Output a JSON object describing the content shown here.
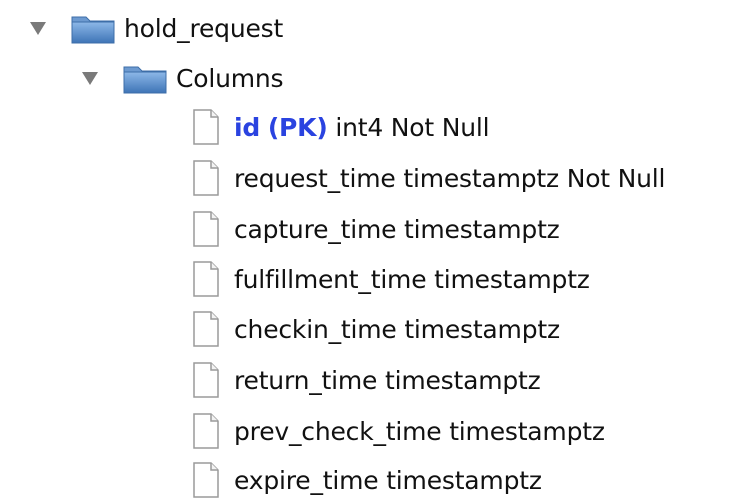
{
  "tree": {
    "table": {
      "name": "hold_request",
      "expanded": true,
      "icon": "folder-icon"
    },
    "columns_folder": {
      "name": "Columns",
      "expanded": true,
      "icon": "folder-icon"
    },
    "columns": [
      {
        "name": "id",
        "pk_label": "(PK)",
        "details": "int4 Not Null",
        "primary_key": true
      },
      {
        "name": "request_time",
        "details": "timestamptz Not Null",
        "primary_key": false
      },
      {
        "name": "capture_time",
        "details": "timestamptz",
        "primary_key": false
      },
      {
        "name": "fulfillment_time",
        "details": "timestamptz",
        "primary_key": false
      },
      {
        "name": "checkin_time",
        "details": "timestamptz",
        "primary_key": false
      },
      {
        "name": "return_time",
        "details": "timestamptz",
        "primary_key": false
      },
      {
        "name": "prev_check_time",
        "details": "timestamptz",
        "primary_key": false
      },
      {
        "name": "expire_time",
        "details": "timestamptz",
        "primary_key": false
      }
    ],
    "colors": {
      "primary_key_text": "#2a43e0",
      "folder_blue": "#4f86c5",
      "toggle_gray": "#777777"
    }
  }
}
